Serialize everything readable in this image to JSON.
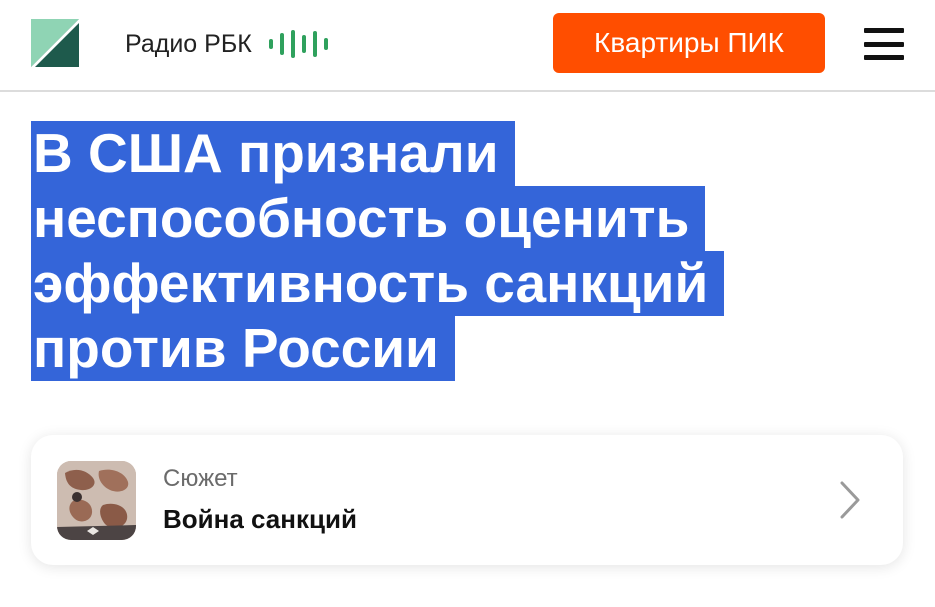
{
  "header": {
    "radio_label": "Радио РБК",
    "promo_button": "Квартиры ПИК",
    "colors": {
      "promo": "#ff4e00",
      "logo_light": "#8fd4b4",
      "logo_dark": "#1e5a4c",
      "wave": "#2fa15d"
    }
  },
  "article": {
    "headline_lines": [
      "В США признали",
      "неспособность оценить",
      "эффективность санкций",
      "против России"
    ],
    "highlight_color": "#3465d9"
  },
  "story": {
    "kicker": "Сюжет",
    "title": "Война санкций",
    "thumbnail": "map-image",
    "chevron": "chevron-right-icon"
  }
}
